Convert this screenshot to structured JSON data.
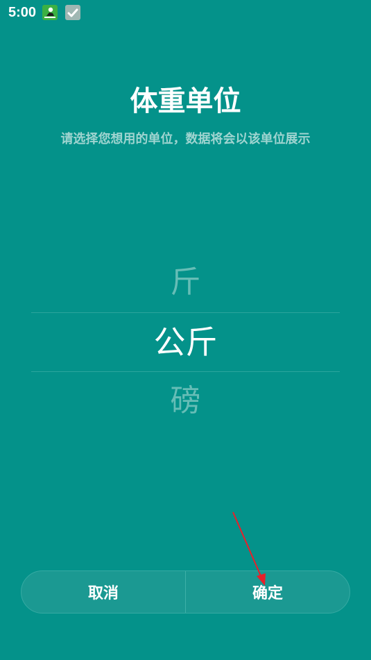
{
  "status_bar": {
    "time": "5:00",
    "icons": [
      "app-notification-icon",
      "check-notification-icon"
    ]
  },
  "header": {
    "title": "体重单位",
    "subtitle": "请选择您想用的单位，数据将会以该单位展示"
  },
  "picker": {
    "options": [
      "斤",
      "公斤",
      "磅"
    ],
    "selected_index": 1
  },
  "buttons": {
    "cancel_label": "取消",
    "confirm_label": "确定"
  },
  "colors": {
    "background": "#04928a",
    "button_bar": "#1b9992",
    "faded_option": "#66bdb6",
    "subtitle": "#9fd4d0",
    "annotation_arrow": "#e8202a"
  }
}
